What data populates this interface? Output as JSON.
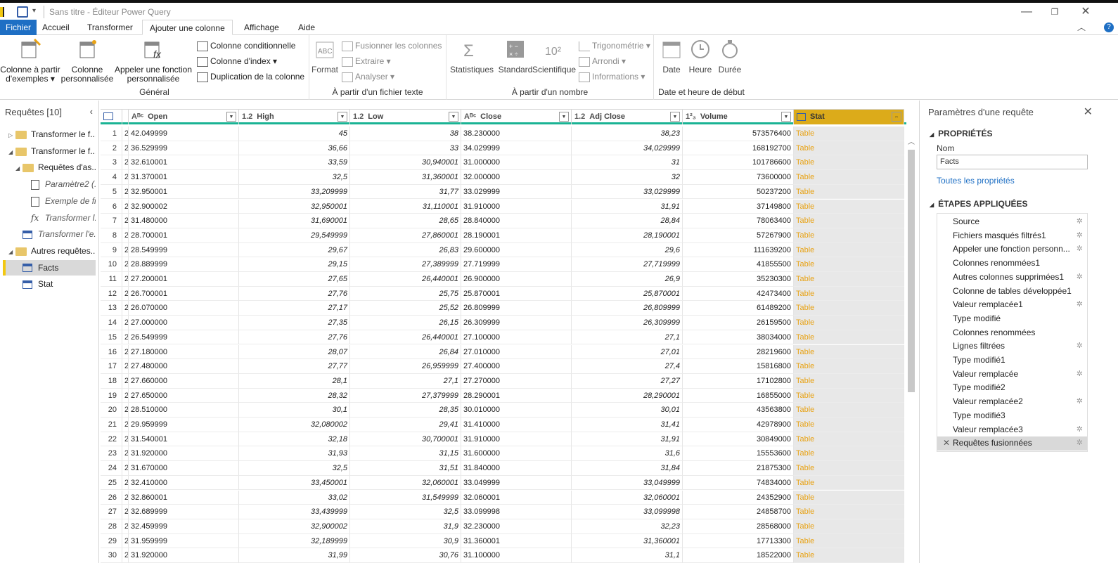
{
  "window": {
    "title": "Sans titre - Éditeur Power Query",
    "min": "—",
    "restore": "❐",
    "close": "✕"
  },
  "menu_tabs": [
    "Fichier",
    "Accueil",
    "Transformer",
    "Ajouter une colonne",
    "Affichage",
    "Aide"
  ],
  "ribbon": {
    "general": {
      "label": "Général",
      "col_examples": [
        "Colonne à partir",
        "d'exemples ▾"
      ],
      "col_custom": [
        "Colonne",
        "personnalisée"
      ],
      "invoke_fn": [
        "Appeler une fonction",
        "personnalisée"
      ],
      "conditional": "Colonne conditionnelle",
      "index": "Colonne d'index ▾",
      "duplicate": "Duplication de la colonne"
    },
    "text": {
      "label": "À partir d'un fichier texte",
      "format": "Format",
      "merge": "Fusionner les colonnes",
      "extract": "Extraire ▾",
      "parse": "Analyser ▾"
    },
    "number": {
      "label": "À partir d'un nombre",
      "stats": "Statistiques",
      "standard": "Standard",
      "scientific": "Scientifique",
      "trig": "Trigonométrie ▾",
      "round": "Arrondi ▾",
      "info": "Informations ▾"
    },
    "date": {
      "label": "Date et heure de début",
      "date": "Date",
      "time": "Heure",
      "duration": "Durée"
    }
  },
  "left_panel": {
    "header": "Requêtes [10]",
    "items": [
      {
        "label": "Transformer le f...",
        "type": "folder",
        "level": 0,
        "arrow": "▷"
      },
      {
        "label": "Transformer le f...",
        "type": "folder",
        "level": 0,
        "arrow": "◢"
      },
      {
        "label": "Requêtes d'as...",
        "type": "folder",
        "level": 1,
        "arrow": "◢"
      },
      {
        "label": "Paramètre2 (...",
        "type": "param",
        "level": 2
      },
      {
        "label": "Exemple de fi...",
        "type": "doc",
        "level": 2
      },
      {
        "label": "Transformer l...",
        "type": "fx",
        "level": 2
      },
      {
        "label": "Transformer l'e...",
        "type": "table",
        "level": 1
      },
      {
        "label": "Autres requêtes...",
        "type": "folder",
        "level": 0,
        "arrow": "◢"
      },
      {
        "label": "Facts",
        "type": "table",
        "level": 1,
        "selected": true
      },
      {
        "label": "Stat",
        "type": "table",
        "level": 1
      }
    ]
  },
  "grid": {
    "columns": [
      {
        "type": "ABC",
        "name": "Open"
      },
      {
        "type": "1.2",
        "name": "High"
      },
      {
        "type": "1.2",
        "name": "Low"
      },
      {
        "type": "ABC",
        "name": "Close"
      },
      {
        "type": "1.2",
        "name": "Adj Close"
      },
      {
        "type": "123",
        "name": "Volume"
      },
      {
        "type": "tbl",
        "name": "Stat"
      }
    ],
    "stub_value": "2",
    "table_label": "Table",
    "rows": [
      [
        "1",
        "42.049999",
        "45",
        "38",
        "38.230000",
        "38,23",
        "573576400"
      ],
      [
        "2",
        "36.529999",
        "36,66",
        "33",
        "34.029999",
        "34,029999",
        "168192700"
      ],
      [
        "3",
        "32.610001",
        "33,59",
        "30,940001",
        "31.000000",
        "31",
        "101786600"
      ],
      [
        "4",
        "31.370001",
        "32,5",
        "31,360001",
        "32.000000",
        "32",
        "73600000"
      ],
      [
        "5",
        "32.950001",
        "33,209999",
        "31,77",
        "33.029999",
        "33,029999",
        "50237200"
      ],
      [
        "6",
        "32.900002",
        "32,950001",
        "31,110001",
        "31.910000",
        "31,91",
        "37149800"
      ],
      [
        "7",
        "31.480000",
        "31,690001",
        "28,65",
        "28.840000",
        "28,84",
        "78063400"
      ],
      [
        "8",
        "28.700001",
        "29,549999",
        "27,860001",
        "28.190001",
        "28,190001",
        "57267900"
      ],
      [
        "9",
        "28.549999",
        "29,67",
        "26,83",
        "29.600000",
        "29,6",
        "111639200"
      ],
      [
        "10",
        "28.889999",
        "29,15",
        "27,389999",
        "27.719999",
        "27,719999",
        "41855500"
      ],
      [
        "11",
        "27.200001",
        "27,65",
        "26,440001",
        "26.900000",
        "26,9",
        "35230300"
      ],
      [
        "12",
        "26.700001",
        "27,76",
        "25,75",
        "25.870001",
        "25,870001",
        "42473400"
      ],
      [
        "13",
        "26.070000",
        "27,17",
        "25,52",
        "26.809999",
        "26,809999",
        "61489200"
      ],
      [
        "14",
        "27.000000",
        "27,35",
        "26,15",
        "26.309999",
        "26,309999",
        "26159500"
      ],
      [
        "15",
        "26.549999",
        "27,76",
        "26,440001",
        "27.100000",
        "27,1",
        "38034000"
      ],
      [
        "16",
        "27.180000",
        "28,07",
        "26,84",
        "27.010000",
        "27,01",
        "28219600"
      ],
      [
        "17",
        "27.480000",
        "27,77",
        "26,959999",
        "27.400000",
        "27,4",
        "15816800"
      ],
      [
        "18",
        "27.660000",
        "28,1",
        "27,1",
        "27.270000",
        "27,27",
        "17102800"
      ],
      [
        "19",
        "27.650000",
        "28,32",
        "27,379999",
        "28.290001",
        "28,290001",
        "16855000"
      ],
      [
        "20",
        "28.510000",
        "30,1",
        "28,35",
        "30.010000",
        "30,01",
        "43563800"
      ],
      [
        "21",
        "29.959999",
        "32,080002",
        "29,41",
        "31.410000",
        "31,41",
        "42978900"
      ],
      [
        "22",
        "31.540001",
        "32,18",
        "30,700001",
        "31.910000",
        "31,91",
        "30849000"
      ],
      [
        "23",
        "31.920000",
        "31,93",
        "31,15",
        "31.600000",
        "31,6",
        "15553600"
      ],
      [
        "24",
        "31.670000",
        "32,5",
        "31,51",
        "31.840000",
        "31,84",
        "21875300"
      ],
      [
        "25",
        "32.410000",
        "33,450001",
        "32,060001",
        "33.049999",
        "33,049999",
        "74834000"
      ],
      [
        "26",
        "32.860001",
        "33,02",
        "31,549999",
        "32.060001",
        "32,060001",
        "24352900"
      ],
      [
        "27",
        "32.689999",
        "33,439999",
        "32,5",
        "33.099998",
        "33,099998",
        "24858700"
      ],
      [
        "28",
        "32.459999",
        "32,900002",
        "31,9",
        "32.230000",
        "32,23",
        "28568000"
      ],
      [
        "29",
        "31.959999",
        "32,189999",
        "30,9",
        "31.360001",
        "31,360001",
        "17713300"
      ],
      [
        "30",
        "31.920000",
        "31,99",
        "30,76",
        "31.100000",
        "31,1",
        "18522000"
      ]
    ]
  },
  "right_panel": {
    "title": "Paramètres d'une requête",
    "properties_header": "PROPRIÉTÉS",
    "name_label": "Nom",
    "name_value": "Facts",
    "all_props_link": "Toutes les propriétés",
    "steps_header": "ÉTAPES APPLIQUÉES",
    "steps": [
      {
        "label": "Source",
        "gear": true
      },
      {
        "label": "Fichiers masqués filtrés1",
        "gear": true
      },
      {
        "label": "Appeler une fonction personn...",
        "gear": true
      },
      {
        "label": "Colonnes renommées1",
        "gear": false
      },
      {
        "label": "Autres colonnes supprimées1",
        "gear": true
      },
      {
        "label": "Colonne de tables développée1",
        "gear": false
      },
      {
        "label": "Valeur remplacée1",
        "gear": true
      },
      {
        "label": "Type modifié",
        "gear": false
      },
      {
        "label": "Colonnes renommées",
        "gear": false
      },
      {
        "label": "Lignes filtrées",
        "gear": true
      },
      {
        "label": "Type modifié1",
        "gear": false
      },
      {
        "label": "Valeur remplacée",
        "gear": true
      },
      {
        "label": "Type modifié2",
        "gear": false
      },
      {
        "label": "Valeur remplacée2",
        "gear": true
      },
      {
        "label": "Type modifié3",
        "gear": false
      },
      {
        "label": "Valeur remplacée3",
        "gear": true
      },
      {
        "label": "Requêtes fusionnées",
        "gear": true,
        "selected": true
      }
    ]
  },
  "colors": {
    "accent_blue": "#1e6fc4",
    "stat_header": "#dcab1a",
    "table_link": "#e8a317",
    "header_underline": "#1ab394"
  }
}
